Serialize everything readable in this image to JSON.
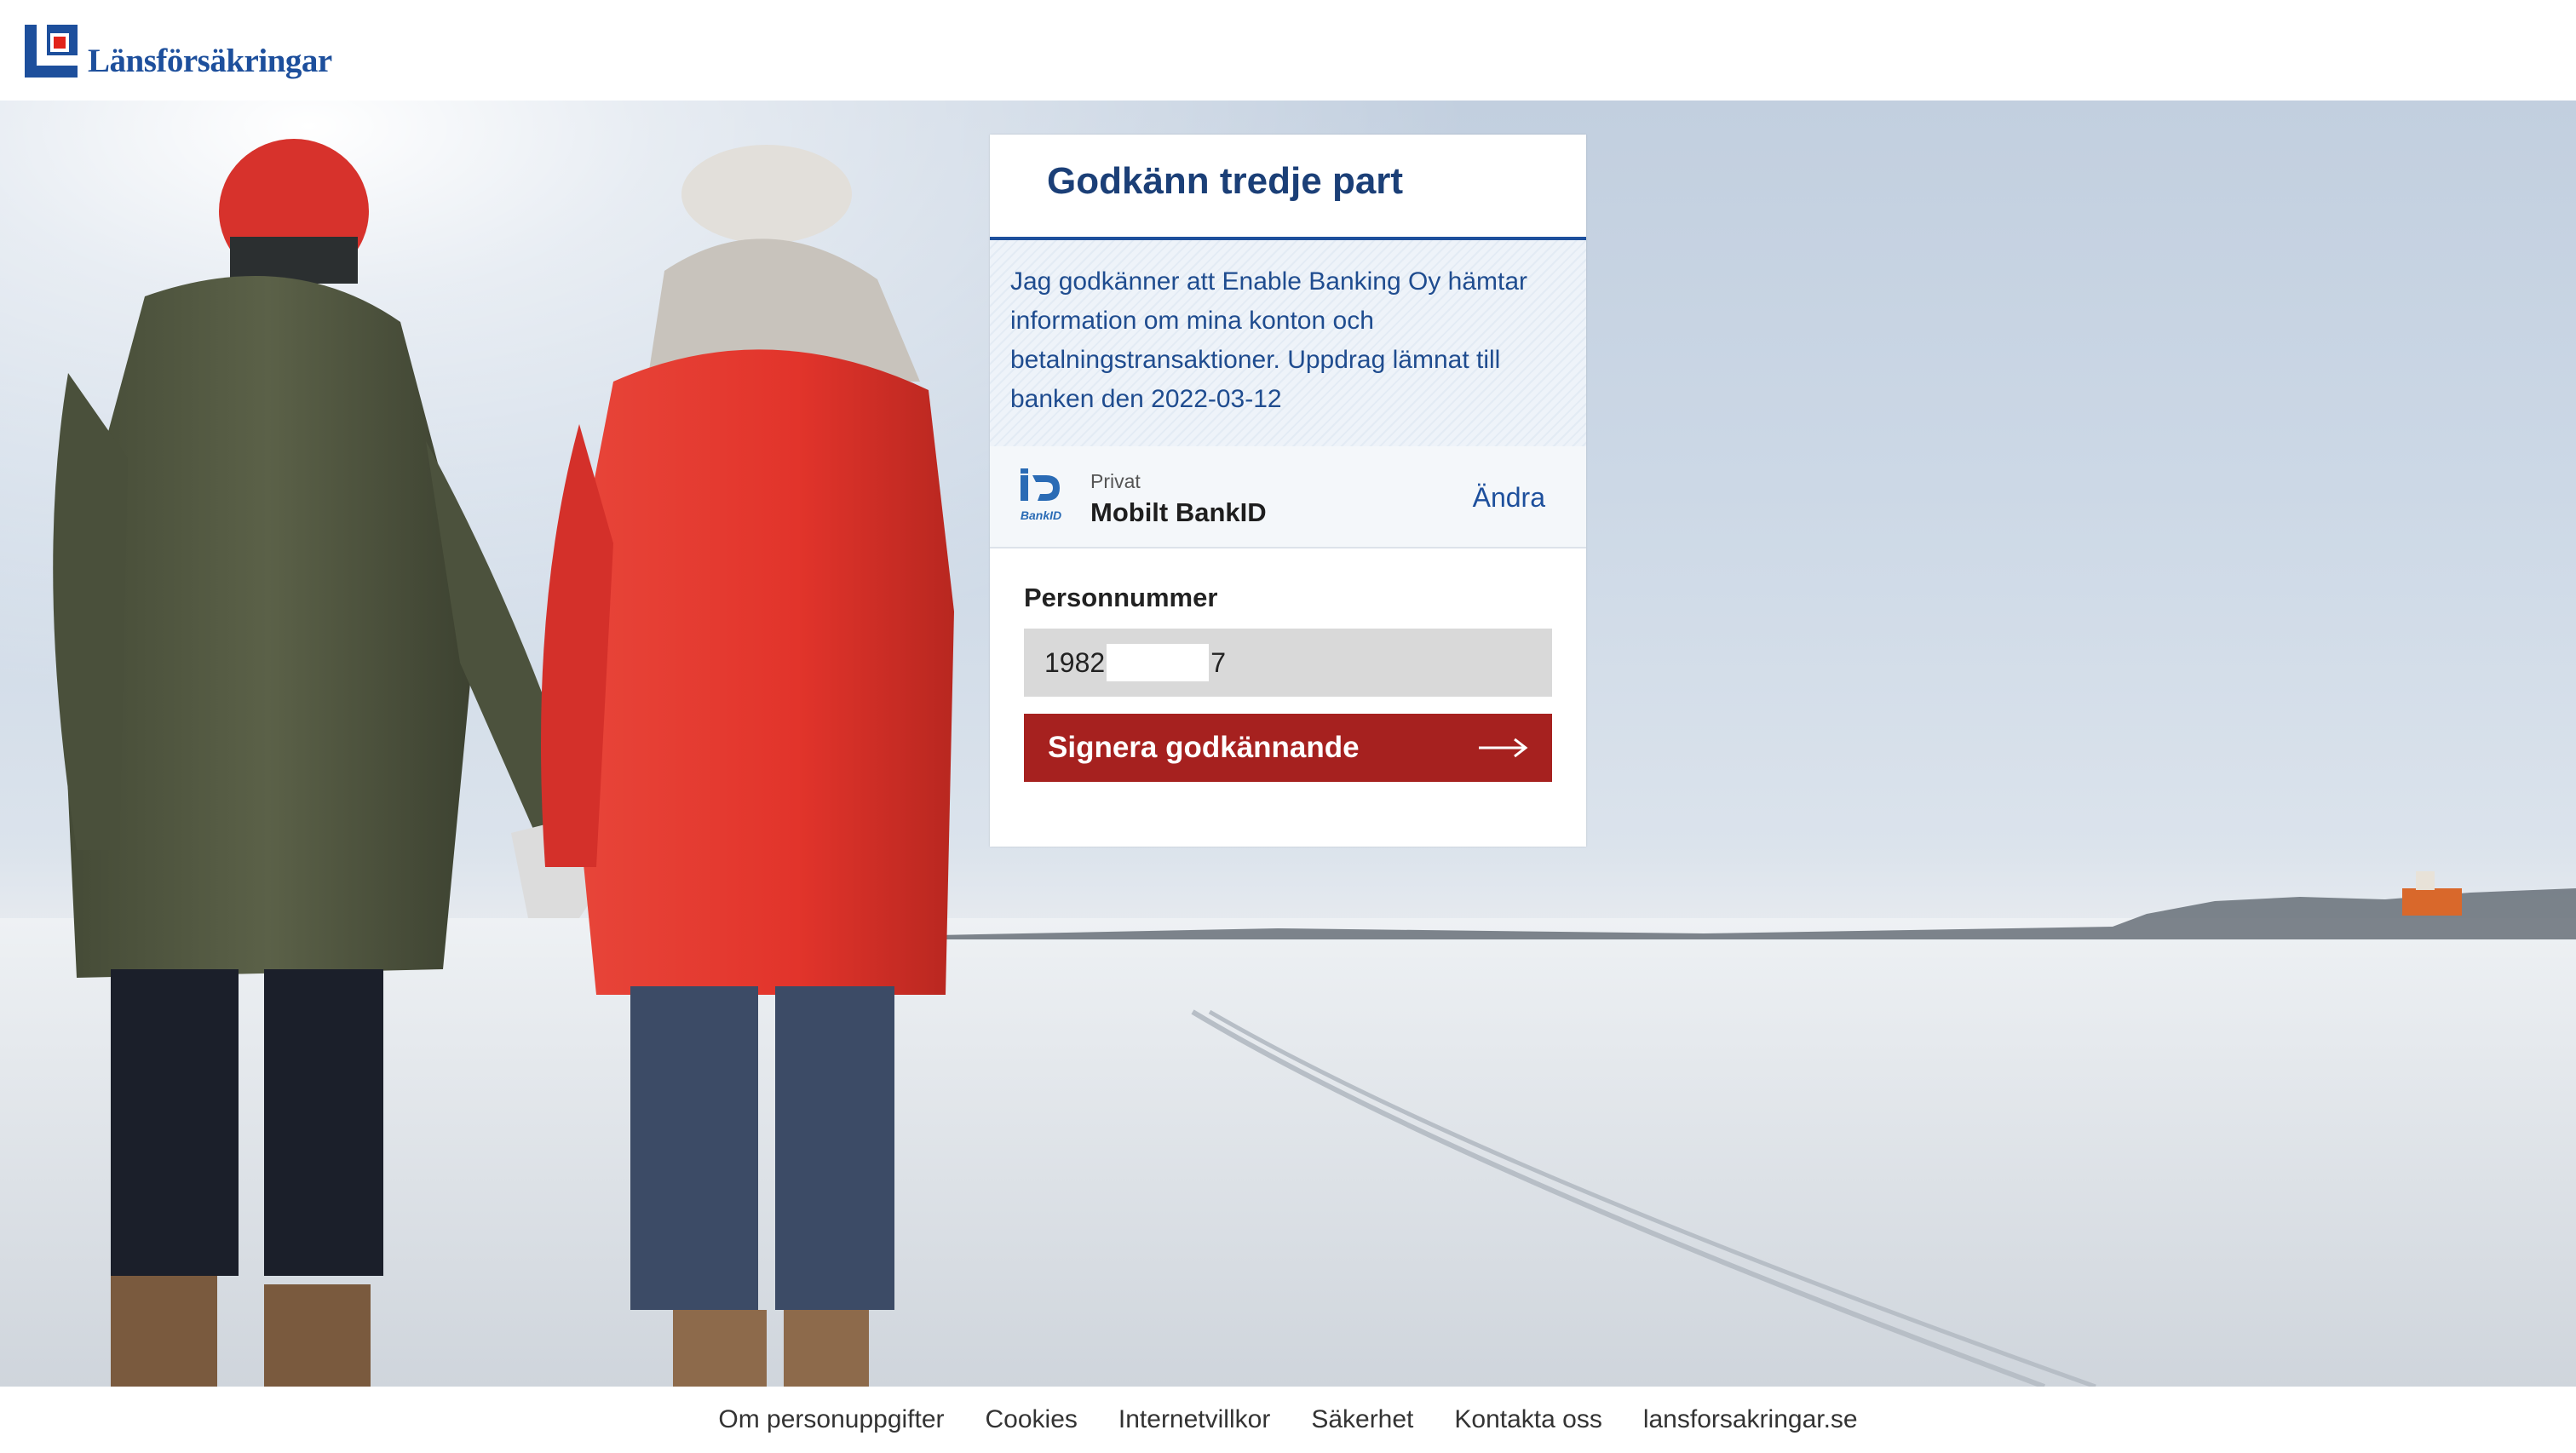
{
  "header": {
    "logo_text": "Länsförsäkringar"
  },
  "card": {
    "title": "Godkänn tredje part",
    "consent_text": "Jag godkänner att Enable Banking Oy hämtar information om mina konton och betalningstransaktioner. Uppdrag lämnat till banken den 2022-03-12",
    "auth": {
      "icon": "bankid-icon",
      "label": "Privat",
      "method": "Mobilt BankID",
      "change_label": "Ändra"
    },
    "form": {
      "field_label": "Personnummer",
      "pnr_prefix": "1982",
      "pnr_suffix": "7",
      "submit_label": "Signera godkännande",
      "submit_icon": "arrow-right-icon"
    }
  },
  "footer": {
    "links": [
      "Om personuppgifter",
      "Cookies",
      "Internetvillkor",
      "Säkerhet",
      "Kontakta oss",
      "lansforsakringar.se"
    ]
  },
  "colors": {
    "brand_blue": "#1d4f9c",
    "brand_red": "#e2231a",
    "button_red": "#a6211f"
  }
}
